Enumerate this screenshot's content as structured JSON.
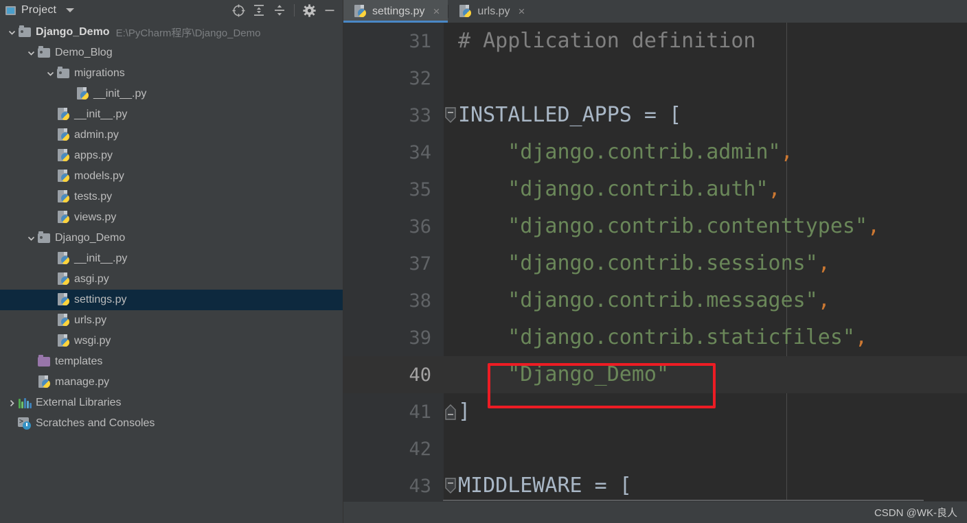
{
  "project_panel": {
    "title": "Project",
    "caret_icon": "chevron-down-icon",
    "toolbar_buttons": [
      {
        "name": "select-opened-file-icon",
        "label": "Select Opened File"
      },
      {
        "name": "expand-all-icon",
        "label": "Expand All"
      },
      {
        "name": "collapse-all-icon",
        "label": "Collapse All"
      },
      {
        "name": "settings-gear-icon",
        "label": "Settings"
      },
      {
        "name": "minimize-icon",
        "label": "Hide"
      }
    ],
    "tree": [
      {
        "label": "Django_Demo",
        "hint": "E:\\PyCharm程序\\Django_Demo",
        "indent": 0,
        "icon": "folder-icon",
        "twisty": "down",
        "kind": "root",
        "selected": false
      },
      {
        "label": "Demo_Blog",
        "hint": "",
        "indent": 1,
        "icon": "folder-icon",
        "twisty": "down",
        "kind": "folder",
        "selected": false
      },
      {
        "label": "migrations",
        "hint": "",
        "indent": 2,
        "icon": "folder-icon",
        "twisty": "down",
        "kind": "folder",
        "selected": false
      },
      {
        "label": "__init__.py",
        "hint": "",
        "indent": 3,
        "icon": "python-file-icon",
        "twisty": "none",
        "kind": "file",
        "selected": false
      },
      {
        "label": "__init__.py",
        "hint": "",
        "indent": 2,
        "icon": "python-file-icon",
        "twisty": "none",
        "kind": "file",
        "selected": false
      },
      {
        "label": "admin.py",
        "hint": "",
        "indent": 2,
        "icon": "python-file-icon",
        "twisty": "none",
        "kind": "file",
        "selected": false
      },
      {
        "label": "apps.py",
        "hint": "",
        "indent": 2,
        "icon": "python-file-icon",
        "twisty": "none",
        "kind": "file",
        "selected": false
      },
      {
        "label": "models.py",
        "hint": "",
        "indent": 2,
        "icon": "python-file-icon",
        "twisty": "none",
        "kind": "file",
        "selected": false
      },
      {
        "label": "tests.py",
        "hint": "",
        "indent": 2,
        "icon": "python-file-icon",
        "twisty": "none",
        "kind": "file",
        "selected": false
      },
      {
        "label": "views.py",
        "hint": "",
        "indent": 2,
        "icon": "python-file-icon",
        "twisty": "none",
        "kind": "file",
        "selected": false
      },
      {
        "label": "Django_Demo",
        "hint": "",
        "indent": 1,
        "icon": "folder-icon",
        "twisty": "down",
        "kind": "folder",
        "selected": false
      },
      {
        "label": "__init__.py",
        "hint": "",
        "indent": 2,
        "icon": "python-file-icon",
        "twisty": "none",
        "kind": "file",
        "selected": false
      },
      {
        "label": "asgi.py",
        "hint": "",
        "indent": 2,
        "icon": "python-file-icon",
        "twisty": "none",
        "kind": "file",
        "selected": false
      },
      {
        "label": "settings.py",
        "hint": "",
        "indent": 2,
        "icon": "python-file-icon",
        "twisty": "none",
        "kind": "file",
        "selected": true
      },
      {
        "label": "urls.py",
        "hint": "",
        "indent": 2,
        "icon": "python-file-icon",
        "twisty": "none",
        "kind": "file",
        "selected": false
      },
      {
        "label": "wsgi.py",
        "hint": "",
        "indent": 2,
        "icon": "python-file-icon",
        "twisty": "none",
        "kind": "file",
        "selected": false
      },
      {
        "label": "templates",
        "hint": "",
        "indent": 1,
        "icon": "folder-purple-icon",
        "twisty": "none",
        "kind": "folder",
        "selected": false
      },
      {
        "label": "manage.py",
        "hint": "",
        "indent": 1,
        "icon": "python-file-icon",
        "twisty": "none",
        "kind": "file",
        "selected": false
      },
      {
        "label": "External Libraries",
        "hint": "",
        "indent": 0,
        "icon": "external-libraries-icon",
        "twisty": "right",
        "kind": "node",
        "selected": false
      },
      {
        "label": "Scratches and Consoles",
        "hint": "",
        "indent": 0,
        "icon": "scratches-icon",
        "twisty": "none",
        "kind": "node",
        "selected": false
      }
    ]
  },
  "editor": {
    "tabs": [
      {
        "label": "settings.py",
        "icon": "python-file-icon",
        "active": true,
        "close_icon": "close-icon"
      },
      {
        "label": "urls.py",
        "icon": "python-file-icon",
        "active": false,
        "close_icon": "close-icon"
      }
    ],
    "lines": [
      {
        "num": "31",
        "fold": "none",
        "current": false,
        "tokens": [
          {
            "t": "# Application definition",
            "c": "c-comment"
          }
        ]
      },
      {
        "num": "32",
        "fold": "none",
        "current": false,
        "tokens": []
      },
      {
        "num": "33",
        "fold": "minus",
        "current": false,
        "tokens": [
          {
            "t": "INSTALLED_APPS",
            "c": "c-ident"
          },
          {
            "t": " = ",
            "c": "c-op"
          },
          {
            "t": "[",
            "c": "c-bracket"
          }
        ]
      },
      {
        "num": "34",
        "fold": "none",
        "current": false,
        "tokens": [
          {
            "t": "    ",
            "c": "c-op"
          },
          {
            "t": "\"django.contrib.admin\"",
            "c": "c-str"
          },
          {
            "t": ",",
            "c": "c-comma"
          }
        ]
      },
      {
        "num": "35",
        "fold": "none",
        "current": false,
        "tokens": [
          {
            "t": "    ",
            "c": "c-op"
          },
          {
            "t": "\"django.contrib.auth\"",
            "c": "c-str"
          },
          {
            "t": ",",
            "c": "c-comma"
          }
        ]
      },
      {
        "num": "36",
        "fold": "none",
        "current": false,
        "tokens": [
          {
            "t": "    ",
            "c": "c-op"
          },
          {
            "t": "\"django.contrib.contenttypes\"",
            "c": "c-str"
          },
          {
            "t": ",",
            "c": "c-comma"
          }
        ]
      },
      {
        "num": "37",
        "fold": "none",
        "current": false,
        "tokens": [
          {
            "t": "    ",
            "c": "c-op"
          },
          {
            "t": "\"django.contrib.sessions\"",
            "c": "c-str"
          },
          {
            "t": ",",
            "c": "c-comma"
          }
        ]
      },
      {
        "num": "38",
        "fold": "none",
        "current": false,
        "tokens": [
          {
            "t": "    ",
            "c": "c-op"
          },
          {
            "t": "\"django.contrib.messages\"",
            "c": "c-str"
          },
          {
            "t": ",",
            "c": "c-comma"
          }
        ]
      },
      {
        "num": "39",
        "fold": "none",
        "current": false,
        "tokens": [
          {
            "t": "    ",
            "c": "c-op"
          },
          {
            "t": "\"django.contrib.staticfiles\"",
            "c": "c-str"
          },
          {
            "t": ",",
            "c": "c-comma"
          }
        ]
      },
      {
        "num": "40",
        "fold": "none",
        "current": true,
        "tokens": [
          {
            "t": "    ",
            "c": "c-op"
          },
          {
            "t": "\"Django_Demo\"",
            "c": "c-str"
          }
        ]
      },
      {
        "num": "41",
        "fold": "endmark",
        "current": false,
        "tokens": [
          {
            "t": "]",
            "c": "c-bracket"
          }
        ]
      },
      {
        "num": "42",
        "fold": "none",
        "current": false,
        "tokens": []
      },
      {
        "num": "43",
        "fold": "minus",
        "current": false,
        "tokens": [
          {
            "t": "MIDDLEWARE",
            "c": "c-ident"
          },
          {
            "t": " = ",
            "c": "c-op"
          },
          {
            "t": "[",
            "c": "c-bracket"
          }
        ]
      }
    ],
    "annotation": {
      "name": "red-highlight-box",
      "color": "#ed1c24"
    },
    "watermark": "CSDN @WK-良人"
  },
  "colors": {
    "panel_bg": "#3c3f41",
    "editor_bg": "#2b2b2b",
    "gutter_bg": "#313335",
    "selection": "#0d293e",
    "accent": "#4a88c7",
    "string": "#6a8759",
    "comma": "#cc7832",
    "identifier": "#a9b7c6",
    "comment": "#808080",
    "annotation_red": "#ed1c24"
  }
}
